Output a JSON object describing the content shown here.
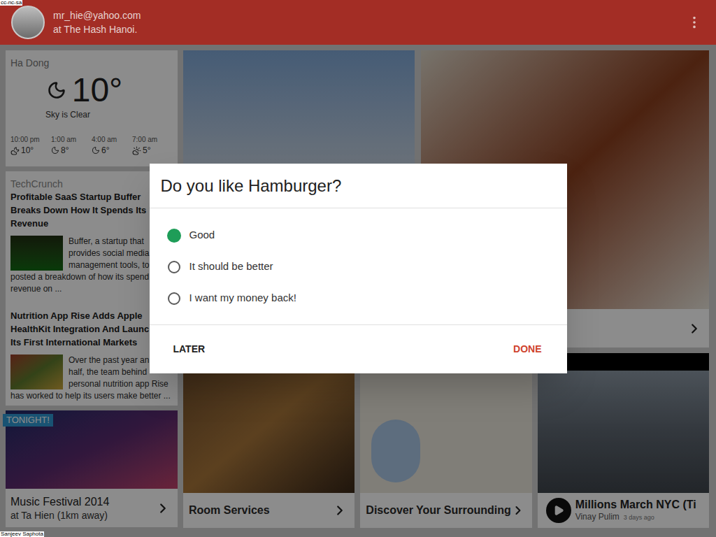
{
  "watermarks": {
    "top": "cc-nc-sa",
    "bottom": "Sanjeev Saphota"
  },
  "header": {
    "email": "mr_hie@yahoo.com",
    "location": "at The Hash Hanoi."
  },
  "weather": {
    "place": "Ha Dong",
    "temperature": "10°",
    "condition": "Sky is Clear",
    "forecast": [
      {
        "time": "10:00 pm",
        "temperature": "10°",
        "kind": "cloudy-night"
      },
      {
        "time": "1:00 am",
        "temperature": "8°",
        "kind": "clear-night"
      },
      {
        "time": "4:00 am",
        "temperature": "6°",
        "kind": "clear-night"
      },
      {
        "time": "7:00 am",
        "temperature": "5°",
        "kind": "partly-cloudy"
      }
    ]
  },
  "news": {
    "source": "TechCrunch",
    "articles": [
      {
        "title_lines": [
          "Profitable SaaS Startup Buffer",
          "Breaks Down How It Spends Its",
          "Revenue"
        ],
        "summary_lines": [
          "Buffer, a startup that",
          "provides social media",
          "management tools, to",
          "posted a breakdown of how its spend",
          "revenue on ..."
        ]
      },
      {
        "title_lines": [
          "Nutrition App Rise Adds Apple",
          "HealthKit Integration And Launc",
          "Its First International Markets"
        ],
        "summary_lines": [
          "Over the past year an",
          "half, the team behind",
          "personal nutrition app Rise",
          "has worked to help its users make better ..."
        ]
      }
    ]
  },
  "event": {
    "badge": "TONIGHT!",
    "title": "Music Festival 2014",
    "subtitle": "at Ta Hien (1km away)"
  },
  "tiles": [
    {
      "title": "Room Services",
      "kind": "photo"
    },
    {
      "title": "Discover Your Surrounding",
      "kind": "map"
    },
    {
      "title": "Millions March NYC (Ti",
      "author": "Vinay Pulim",
      "time": "3 days ago",
      "kind": "video"
    }
  ],
  "dialog": {
    "title": "Do you like Hamburger?",
    "options": [
      {
        "label": "Good",
        "selected": true
      },
      {
        "label": "It should be better",
        "selected": false
      },
      {
        "label": "I want my money back!",
        "selected": false
      }
    ],
    "buttons": [
      {
        "label": "LATER",
        "kind": "neutral"
      },
      {
        "label": "DONE",
        "kind": "primary"
      }
    ]
  }
}
